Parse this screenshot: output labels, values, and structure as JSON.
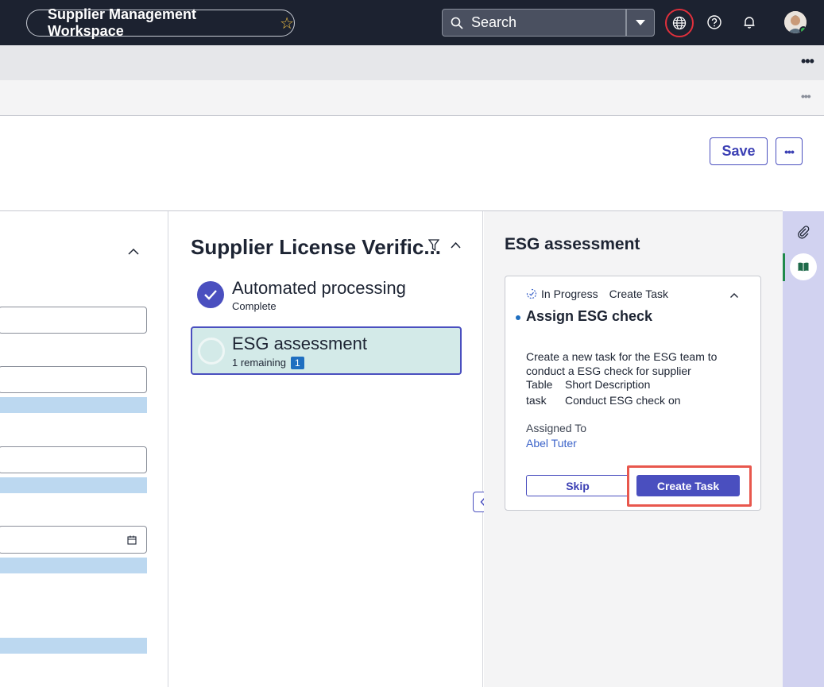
{
  "topbar": {
    "workspace_title": "Supplier Management Workspace",
    "search_placeholder": "Search"
  },
  "header": {
    "save_label": "Save"
  },
  "playbook": {
    "title": "Supplier License Verific...",
    "steps": [
      {
        "label": "Automated processing",
        "status": "Complete"
      },
      {
        "label": "ESG assessment",
        "status": "1 remaining",
        "badge": "1"
      }
    ]
  },
  "detail": {
    "title": "ESG assessment",
    "card": {
      "status": "In Progress",
      "type": "Create Task",
      "task_title": "Assign ESG check",
      "description": "Create a new task for the ESG team to conduct a ESG check for supplier",
      "rows": [
        {
          "key": "Table",
          "value": "Short Description"
        },
        {
          "key": "task",
          "value": "Conduct ESG check on"
        }
      ],
      "assigned_label": "Assigned To",
      "assigned_value": "Abel Tuter",
      "skip_label": "Skip",
      "create_label": "Create Task"
    }
  },
  "colors": {
    "accent": "#4a4fbf",
    "highlight": "#e8574d",
    "active_step_bg": "#d3eae8"
  }
}
